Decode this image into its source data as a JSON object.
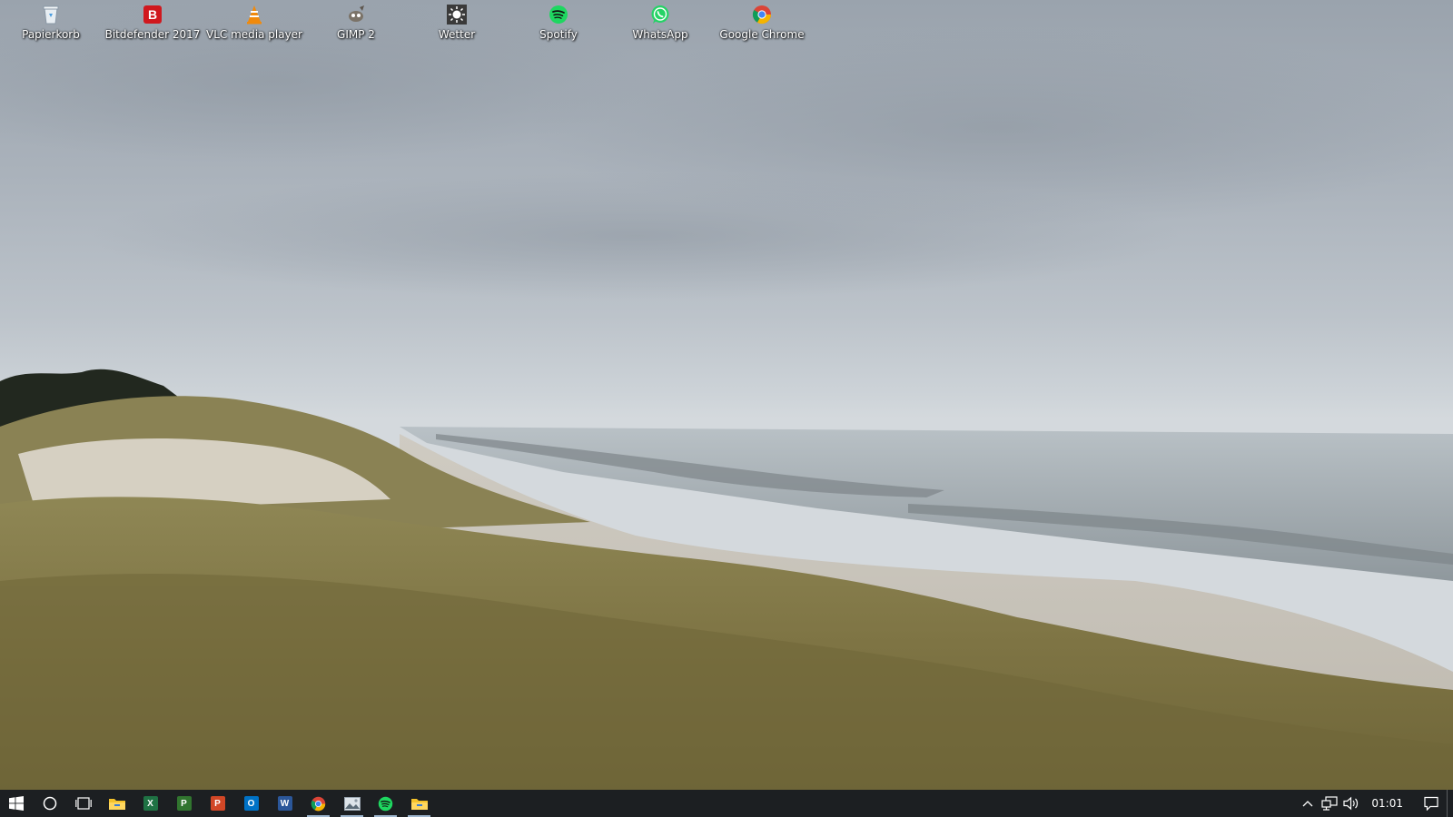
{
  "desktop": {
    "icons": [
      {
        "label": "Papierkorb",
        "icon": "recycle-bin-icon"
      },
      {
        "label": "Bitdefender 2017",
        "icon": "bitdefender-icon",
        "color": "#d0181e"
      },
      {
        "label": "VLC media player",
        "icon": "vlc-cone-icon",
        "color": "#f08a0c"
      },
      {
        "label": "GIMP 2",
        "icon": "gimp-icon"
      },
      {
        "label": "Wetter",
        "icon": "weather-sun-icon"
      },
      {
        "label": "Spotify",
        "icon": "spotify-icon",
        "color": "#1ed760"
      },
      {
        "label": "WhatsApp",
        "icon": "whatsapp-icon",
        "color": "#25d366"
      },
      {
        "label": "Google Chrome",
        "icon": "chrome-icon"
      }
    ]
  },
  "taskbar": {
    "start_icon": "windows-logo-icon",
    "search_icon": "cortana-circle-icon",
    "task_view_icon": "task-view-icon",
    "apps": [
      {
        "icon": "file-explorer-icon",
        "color": "#f4c22b"
      },
      {
        "icon": "excel-icon",
        "letter": "X",
        "color": "#1f7244"
      },
      {
        "icon": "project-icon",
        "letter": "P",
        "color": "#31752f"
      },
      {
        "icon": "powerpoint-icon",
        "letter": "P",
        "color": "#d24726"
      },
      {
        "icon": "outlook-icon",
        "letter": "O",
        "color": "#0072c6"
      },
      {
        "icon": "word-icon",
        "letter": "W",
        "color": "#2b579a"
      },
      {
        "icon": "chrome-icon"
      },
      {
        "icon": "photos-icon"
      },
      {
        "icon": "spotify-icon",
        "color": "#1ed760"
      },
      {
        "icon": "file-explorer-icon",
        "color": "#f4c22b"
      }
    ],
    "tray": {
      "chevron_icon": "chevron-up-icon",
      "network_icon": "network-icon",
      "volume_icon": "volume-icon",
      "clock": "01:01",
      "action_center_icon": "action-center-icon"
    }
  }
}
